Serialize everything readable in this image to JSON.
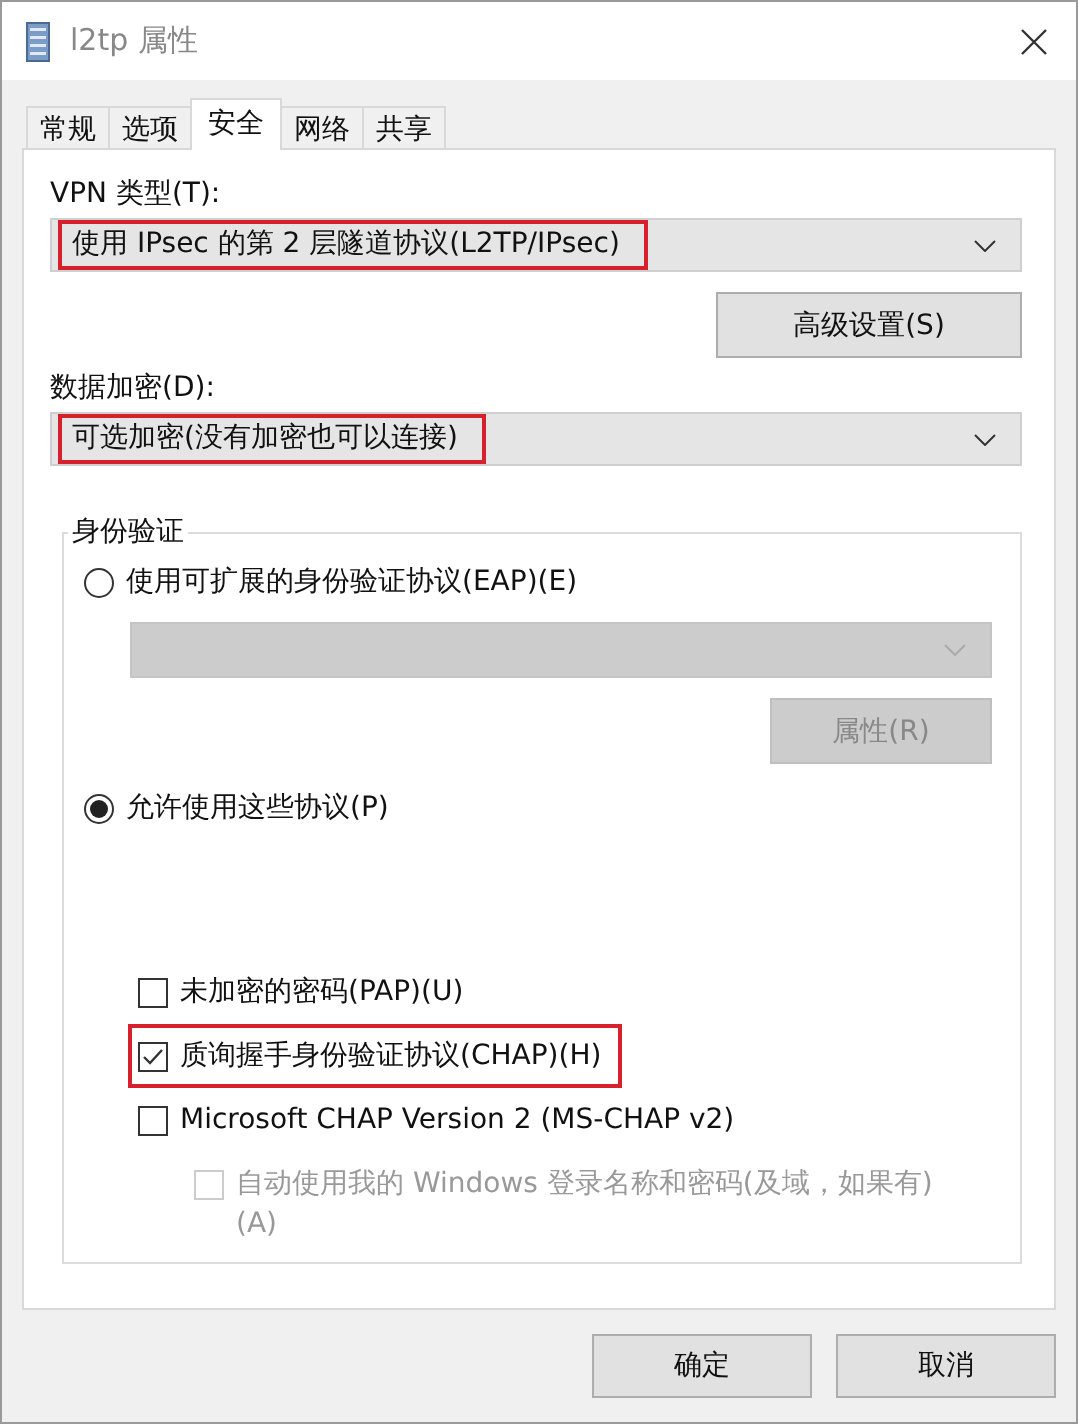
{
  "window": {
    "title": "l2tp 属性"
  },
  "tabs": [
    {
      "label": "常规",
      "selected": false
    },
    {
      "label": "选项",
      "selected": false
    },
    {
      "label": "安全",
      "selected": true
    },
    {
      "label": "网络",
      "selected": false
    },
    {
      "label": "共享",
      "selected": false
    }
  ],
  "vpn_type": {
    "label": "VPN 类型(T):",
    "value": "使用 IPsec 的第 2 层隧道协议(L2TP/IPsec)",
    "highlighted": true
  },
  "advanced_button": "高级设置(S)",
  "encryption": {
    "label": "数据加密(D):",
    "value": "可选加密(没有加密也可以连接)",
    "highlighted": true
  },
  "authentication": {
    "title": "身份验证",
    "options": [
      {
        "label": "使用可扩展的身份验证协议(EAP)(E)",
        "selected": false
      },
      {
        "label": "允许使用这些协议(P)",
        "selected": true
      }
    ],
    "eap_dropdown": {
      "disabled": true
    },
    "properties_button": {
      "label": "属性(R)",
      "disabled": true
    },
    "protocols": [
      {
        "label": "未加密的密码(PAP)(U)",
        "checked": false,
        "disabled": false,
        "highlighted": false
      },
      {
        "label": "质询握手身份验证协议(CHAP)(H)",
        "checked": true,
        "disabled": false,
        "highlighted": true
      },
      {
        "label": "Microsoft CHAP Version 2 (MS-CHAP v2)",
        "checked": false,
        "disabled": false,
        "highlighted": false,
        "children": [
          {
            "label": "自动使用我的 Windows 登录名称和密码(及域，如果有)(A)",
            "checked": false,
            "disabled": true
          }
        ]
      }
    ]
  },
  "buttons": [
    "确定",
    "取消"
  ]
}
